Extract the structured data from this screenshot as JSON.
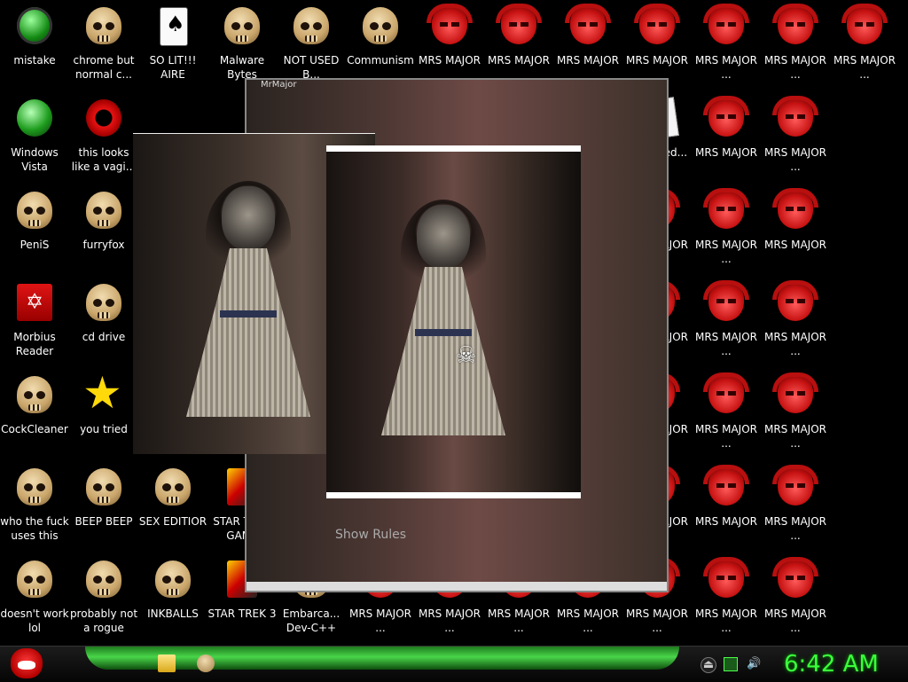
{
  "desktop": {
    "icons": [
      {
        "label": "mistake",
        "type": "green-orb"
      },
      {
        "label": "chrome but normal c...",
        "type": "skull"
      },
      {
        "label": "SO LIT!!! AIRE",
        "type": "card"
      },
      {
        "label": "Malware Bytes",
        "type": "skull"
      },
      {
        "label": "NOT USED B...",
        "type": "skull"
      },
      {
        "label": "Communism",
        "type": "skull"
      },
      {
        "label": "MRS MAJOR",
        "type": "devil"
      },
      {
        "label": "MRS MAJOR",
        "type": "devil"
      },
      {
        "label": "MRS MAJOR",
        "type": "devil"
      },
      {
        "label": "MRS MAJOR",
        "type": "devil"
      },
      {
        "label": "MRS MAJOR ...",
        "type": "devil"
      },
      {
        "label": "MRS MAJOR ...",
        "type": "devil"
      },
      {
        "label": "MRS MAJOR ...",
        "type": "devil"
      },
      {
        "label": "Windows Vista",
        "type": "recycle"
      },
      {
        "label": "this looks like a vagi...",
        "type": "opera"
      },
      {
        "label": "PeniS",
        "type": "skull"
      },
      {
        "label": "furryfox",
        "type": "skull"
      },
      {
        "label": "Morbius Reader",
        "type": "pdf"
      },
      {
        "label": "cd drive",
        "type": "skull"
      },
      {
        "label": "CockCleaner",
        "type": "skull"
      },
      {
        "label": "you tried",
        "type": "star"
      },
      {
        "label": "who the fuck uses this",
        "type": "skull"
      },
      {
        "label": "BEEP BEEP",
        "type": "skull"
      },
      {
        "label": "SEX EDITIOR",
        "type": "skull"
      },
      {
        "label": "STAR TREK GAME",
        "type": "trek"
      },
      {
        "label": "doesn't work lol",
        "type": "skull"
      },
      {
        "label": "probably not a rogue",
        "type": "skull"
      },
      {
        "label": "INKBALLS",
        "type": "skull"
      },
      {
        "label": "STAR TREK 3",
        "type": "trek"
      },
      {
        "label": "Embarca... Dev-C++",
        "type": "skull"
      },
      {
        "label": "MRS MAJOR ...",
        "type": "devil"
      },
      {
        "label": "MRS MAJOR ...",
        "type": "devil"
      },
      {
        "label": "MRS MAJOR ...",
        "type": "devil"
      },
      {
        "label": "MRS MAJOR ...",
        "type": "devil"
      },
      {
        "label": "MRS MAJOR ...",
        "type": "devil"
      },
      {
        "label": "MRS MAJOR ...",
        "type": "devil"
      },
      {
        "label": "MRS MAJOR ...",
        "type": "devil"
      },
      {
        "label": "Activated...",
        "type": "paper"
      },
      {
        "label": "MRS MAJOR",
        "type": "devil"
      },
      {
        "label": "MRS MAJOR ...",
        "type": "devil"
      },
      {
        "label": "MRS MAJOR ...",
        "type": "devil"
      },
      {
        "label": "MRS MAJOR ...",
        "type": "devil"
      },
      {
        "label": "MRS MAJOR",
        "type": "devil"
      },
      {
        "label": "MRS MAJOR ...",
        "type": "devil"
      },
      {
        "label": "MRS MAJOR ...",
        "type": "devil"
      },
      {
        "label": "MRS MAJOR ...",
        "type": "devil"
      },
      {
        "label": "MRS MAJOR",
        "type": "devil"
      },
      {
        "label": "MRS MAJOR ...",
        "type": "devil"
      },
      {
        "label": "MRS MAJOR ...",
        "type": "devil"
      },
      {
        "label": "MRS MAJOR ...",
        "type": "devil"
      },
      {
        "label": "MRS MAJOR",
        "type": "devil"
      },
      {
        "label": "MRS MAJOR ...",
        "type": "devil"
      },
      {
        "label": "MRS MAJOR ...",
        "type": "devil"
      },
      {
        "label": "MRS MAJOR ...",
        "type": "devil"
      },
      {
        "label": "MRS MAJOR",
        "type": "devil"
      },
      {
        "label": "MRS MAJOR ...",
        "type": "devil"
      },
      {
        "label": "MRS MAJOR ...",
        "type": "devil"
      },
      {
        "label": "MRS MAJOR ...",
        "type": "devil"
      },
      {
        "label": "MRS MAJOR",
        "type": "devil"
      },
      {
        "label": "MRS MAJOR ...",
        "type": "devil"
      },
      {
        "label": "MRS MAJOR ...",
        "type": "devil"
      },
      {
        "label": "MRS MAJOR ...",
        "type": "devil"
      }
    ]
  },
  "windows": {
    "back_title": "MrMajor",
    "back_ghost_text": "Show Rules"
  },
  "taskbar": {
    "start_icon": "angry-bird-icon",
    "pinned": [
      "folder-icon",
      "skull-icon"
    ],
    "tray": [
      "eject-icon",
      "network-icon",
      "volume-icon"
    ],
    "clock": "6:42 AM"
  },
  "colors": {
    "taskbar_accent": "#49d649",
    "clock": "#3bff3b",
    "devil_red": "#c71212"
  }
}
